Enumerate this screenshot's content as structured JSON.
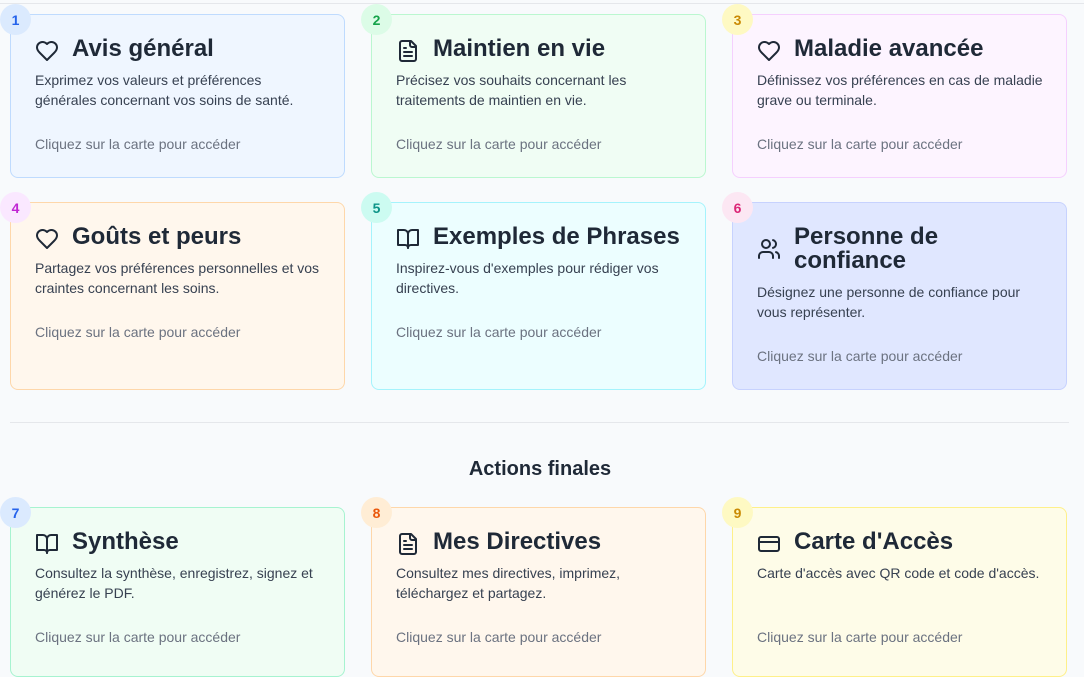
{
  "cards": [
    {
      "number": "1",
      "icon": "heart-icon",
      "title": "Avis général",
      "description": "Exprimez vos valeurs et préférences générales concernant vos soins de santé.",
      "cta": "Cliquez sur la carte pour accéder",
      "bg": "#eff6ff",
      "border": "#bfdbfe",
      "badge_bg": "#dbeafe",
      "badge_fg": "#2563eb"
    },
    {
      "number": "2",
      "icon": "document-icon",
      "title": "Maintien en vie",
      "description": "Précisez vos souhaits concernant les traitements de maintien en vie.",
      "cta": "Cliquez sur la carte pour accéder",
      "bg": "#f0fdf4",
      "border": "#bbf7d0",
      "badge_bg": "#dcfce7",
      "badge_fg": "#16a34a"
    },
    {
      "number": "3",
      "icon": "heart-icon",
      "title": "Maladie avancée",
      "description": "Définissez vos préférences en cas de maladie grave ou terminale.",
      "cta": "Cliquez sur la carte pour accéder",
      "bg": "#fdf4ff",
      "border": "#f5d0fe",
      "badge_bg": "#fef9c3",
      "badge_fg": "#ca8a04"
    },
    {
      "number": "4",
      "icon": "heart-icon",
      "title": "Goûts et peurs",
      "description": "Partagez vos préférences personnelles et vos craintes concernant les soins.",
      "cta": "Cliquez sur la carte pour accéder",
      "bg": "#fff7ed",
      "border": "#fed7aa",
      "badge_bg": "#fae8ff",
      "badge_fg": "#c026d3"
    },
    {
      "number": "5",
      "icon": "book-icon",
      "title": "Exemples de Phrases",
      "description": "Inspirez-vous d'exemples pour rédiger vos directives.",
      "cta": "Cliquez sur la carte pour accéder",
      "bg": "#ecfeff",
      "border": "#a5f3fc",
      "badge_bg": "#ccfbf1",
      "badge_fg": "#0d9488"
    },
    {
      "number": "6",
      "icon": "users-icon",
      "title": "Personne de confiance",
      "description": "Désignez une personne de confiance pour vous représenter.",
      "cta": "Cliquez sur la carte pour accéder",
      "bg": "#e0e7ff",
      "border": "#c7d2fe",
      "badge_bg": "#fce7f3",
      "badge_fg": "#db2777"
    },
    {
      "number": "7",
      "icon": "book-icon",
      "title": "Synthèse",
      "description": "Consultez la synthèse, enregistrez, signez et générez le PDF.",
      "cta": "Cliquez sur la carte pour accéder",
      "bg": "#f0fdf4",
      "border": "#a7f3d0",
      "badge_bg": "#dbeafe",
      "badge_fg": "#2563eb"
    },
    {
      "number": "8",
      "icon": "document-icon",
      "title": "Mes Directives",
      "description": "Consultez mes directives, imprimez, téléchargez et partagez.",
      "cta": "Cliquez sur la carte pour accéder",
      "bg": "#fff7ed",
      "border": "#fed7aa",
      "badge_bg": "#ffedd5",
      "badge_fg": "#ea580c"
    },
    {
      "number": "9",
      "icon": "card-icon",
      "title": "Carte d'Accès",
      "description": "Carte d'accès avec QR code et code d'accès.",
      "cta": "Cliquez sur la carte pour accéder",
      "bg": "#fefce8",
      "border": "#fef08a",
      "badge_bg": "#fef9c3",
      "badge_fg": "#ca8a04"
    }
  ],
  "section": {
    "title": "Actions finales"
  }
}
